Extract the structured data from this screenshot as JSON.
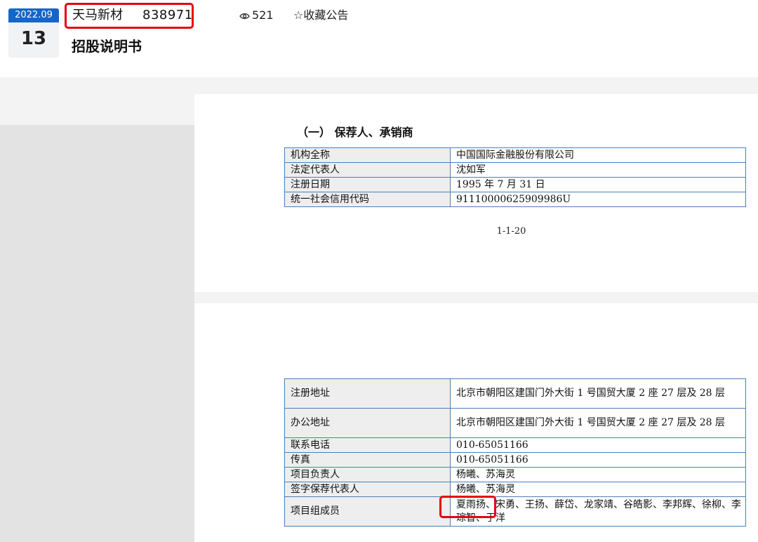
{
  "header": {
    "month": "2022.09",
    "day": "13",
    "company_name": "天马新材",
    "company_code": "838971",
    "view_icon": "eye-icon",
    "views": "521",
    "collect_icon": "star-outline-icon",
    "collect_label": "☆收藏公告",
    "doc_title": "招股说明书",
    "accent_color": "#1466c8",
    "highlight_color": "#e60012"
  },
  "page1": {
    "section_heading": "（一） 保荐人、承销商",
    "rows": [
      {
        "label": "机构全称",
        "value": "中国国际金融股份有限公司"
      },
      {
        "label": "法定代表人",
        "value": "沈如军"
      },
      {
        "label": "注册日期",
        "value": "1995 年 7 月 31 日"
      },
      {
        "label": "统一社会信用代码",
        "value": "91110000625909986U"
      }
    ],
    "page_number": "1-1-20"
  },
  "page2": {
    "rows": [
      {
        "label": "注册地址",
        "value": "北京市朝阳区建国门外大街 1 号国贸大厦 2 座 27 层及 28 层"
      },
      {
        "label": "办公地址",
        "value": "北京市朝阳区建国门外大街 1 号国贸大厦 2 座 27 层及 28 层"
      },
      {
        "label": "联系电话",
        "value": "010-65051166"
      },
      {
        "label": "传真",
        "value": "010-65051166"
      },
      {
        "label": "项目负责人",
        "value": "杨曦、苏海灵"
      },
      {
        "label": "签字保荐代表人",
        "value": "杨曦、苏海灵"
      },
      {
        "label": "项目组成员",
        "value": "夏雨扬、宋勇、王扬、薛岱、龙家靖、谷皓影、李邦辉、徐柳、李琮智、于洋"
      }
    ]
  }
}
